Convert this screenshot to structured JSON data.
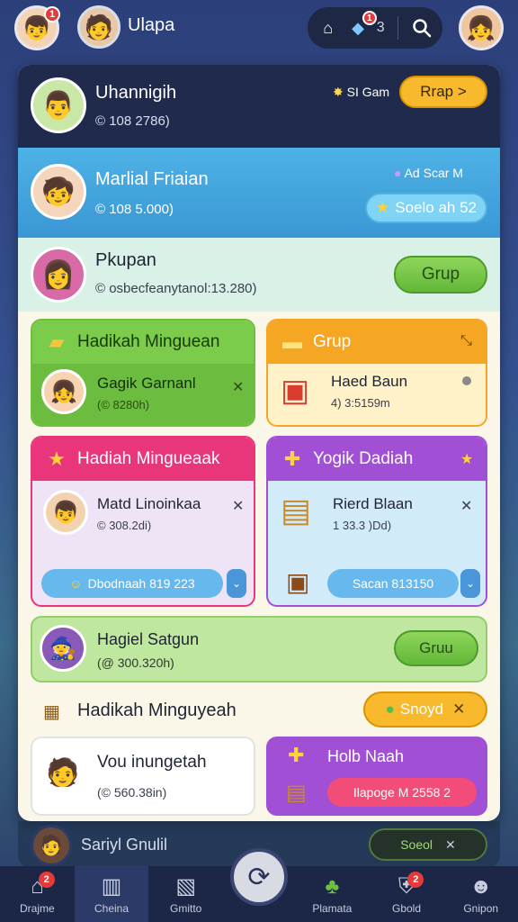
{
  "topbar": {
    "username": "Ulapa",
    "avatar_badge": "1",
    "pill_badge": "1",
    "pill_count": "3"
  },
  "rows": [
    {
      "name": "Uhannigih",
      "sub": "© 108 2786)",
      "reward": "SI Gam",
      "button": "Rrap >"
    },
    {
      "name": "Marlial Friaian",
      "sub": "© 108 5.000)",
      "reward": "Ad Scar M",
      "button": "Soelo ah 52"
    },
    {
      "name": "Pkupan",
      "sub": "© osbecfeanytanol:13.280)",
      "button": "Grup"
    }
  ],
  "cards": [
    {
      "title": "Hadikah Minguean",
      "name": "Gagik Garnanl",
      "sub": "(© 8280h)"
    },
    {
      "title": "Grup",
      "name": "Haed Baun",
      "sub": "4) 3:5159m"
    },
    {
      "title": "Hadiah Mingueaak",
      "name": "Matd Linoinkaa",
      "sub": "© 308.2di)",
      "button": "Dbodnaah 819 223"
    },
    {
      "title": "Yogik Dadiah",
      "name": "Rierd Blaan",
      "sub": "1 33.3 )Dd)",
      "button": "Sacan 813150"
    }
  ],
  "row_mid": {
    "name": "Hagiel Satgun",
    "sub": "(@ 300.320h)",
    "button": "Gruu"
  },
  "section": {
    "title": "Hadikah Minguyeah",
    "button": "Snoyd"
  },
  "bottom_cards": [
    {
      "name": "Vou inungetah",
      "sub": "(© 560.38in)"
    },
    {
      "title": "Holb Naah",
      "button": "Ilapoge M 2558 2"
    }
  ],
  "under": {
    "name": "Sariyl Gnulil",
    "button": "Soeol"
  },
  "nav": [
    {
      "label": "Drajme",
      "badge": "2"
    },
    {
      "label": "Cheina"
    },
    {
      "label": "Gmitto"
    },
    {
      "label": "Plamata"
    },
    {
      "label": "Gbold",
      "badge": "2"
    },
    {
      "label": "Gnipon"
    }
  ],
  "colors": {
    "accent_orange": "#f5a623",
    "accent_green": "#6cc03e",
    "accent_pink": "#e9367a",
    "accent_purple": "#a14fd4"
  }
}
